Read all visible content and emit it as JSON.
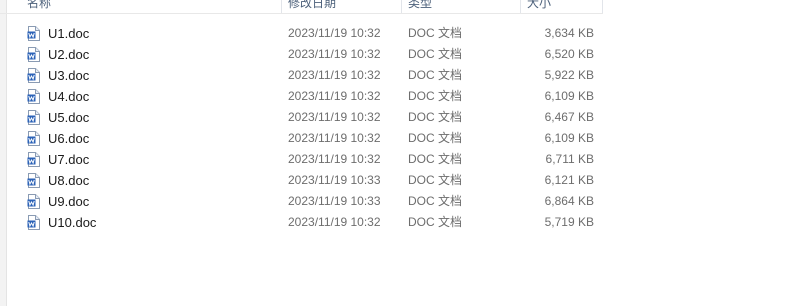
{
  "columns": {
    "name": "名称",
    "date": "修改日期",
    "type": "类型",
    "size": "大小"
  },
  "files": [
    {
      "name": "U1.doc",
      "date": "2023/11/19 10:32",
      "type": "DOC 文档",
      "size": "3,634 KB",
      "icon": "word-doc-icon"
    },
    {
      "name": "U2.doc",
      "date": "2023/11/19 10:32",
      "type": "DOC 文档",
      "size": "6,520 KB",
      "icon": "word-doc-icon"
    },
    {
      "name": "U3.doc",
      "date": "2023/11/19 10:32",
      "type": "DOC 文档",
      "size": "5,922 KB",
      "icon": "word-doc-icon"
    },
    {
      "name": "U4.doc",
      "date": "2023/11/19 10:32",
      "type": "DOC 文档",
      "size": "6,109 KB",
      "icon": "word-doc-icon"
    },
    {
      "name": "U5.doc",
      "date": "2023/11/19 10:32",
      "type": "DOC 文档",
      "size": "6,467 KB",
      "icon": "word-doc-icon"
    },
    {
      "name": "U6.doc",
      "date": "2023/11/19 10:32",
      "type": "DOC 文档",
      "size": "6,109 KB",
      "icon": "word-doc-icon"
    },
    {
      "name": "U7.doc",
      "date": "2023/11/19 10:32",
      "type": "DOC 文档",
      "size": "6,711 KB",
      "icon": "word-doc-icon"
    },
    {
      "name": "U8.doc",
      "date": "2023/11/19 10:33",
      "type": "DOC 文档",
      "size": "6,121 KB",
      "icon": "word-doc-icon"
    },
    {
      "name": "U9.doc",
      "date": "2023/11/19 10:33",
      "type": "DOC 文档",
      "size": "6,864 KB",
      "icon": "word-doc-icon"
    },
    {
      "name": "U10.doc",
      "date": "2023/11/19 10:32",
      "type": "DOC 文档",
      "size": "5,719 KB",
      "icon": "word-doc-icon"
    }
  ],
  "colors": {
    "header_text": "#4c607a",
    "detail_text": "#6d6d6d",
    "icon_blue": "#2b62b7"
  }
}
